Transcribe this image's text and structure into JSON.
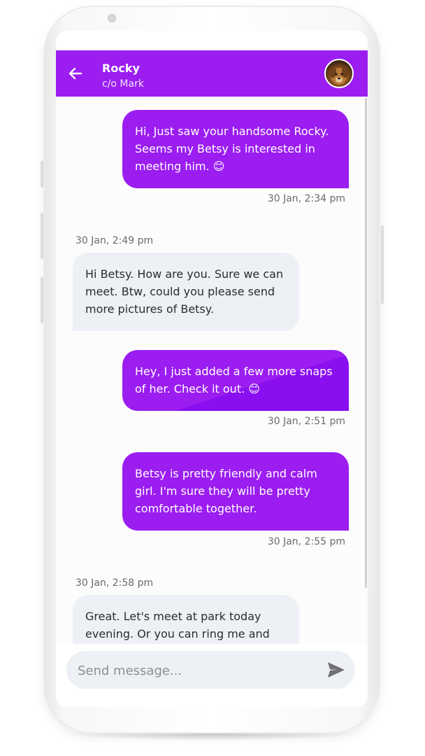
{
  "header": {
    "name": "Rocky",
    "subtitle": "c/o Mark"
  },
  "messages": [
    {
      "direction": "out",
      "text": "Hi, Just saw your handsome Rocky. Seems my Betsy is interested in meeting him. 😊",
      "time": "30 Jan, 2:34 pm"
    },
    {
      "direction": "in",
      "text": "Hi Betsy. How are you. Sure we can meet. Btw, could you please send more pictures of Betsy.",
      "time": "30 Jan, 2:49 pm"
    },
    {
      "direction": "out",
      "text": "Hey, I just added a few more snaps of her. Check it out. 😊",
      "time": "30 Jan, 2:51 pm"
    },
    {
      "direction": "out",
      "text": "Betsy is pretty friendly and calm girl. I'm sure they will be pretty comfortable together.",
      "time": "30 Jan, 2:55 pm"
    },
    {
      "direction": "in",
      "text": "Great. Let's meet at park today evening. Or you can ring me and",
      "time": "30 Jan, 2:58 pm"
    }
  ],
  "composer": {
    "placeholder": "Send message...",
    "value": ""
  },
  "icons": {
    "back": "arrow-left-icon",
    "send": "send-icon",
    "avatar": "dog-avatar"
  },
  "colors": {
    "header": "#9b1df0",
    "outgoing_bubble": "#9b1df0",
    "incoming_bubble": "#edf0f4",
    "composer": "#edf0f4"
  }
}
